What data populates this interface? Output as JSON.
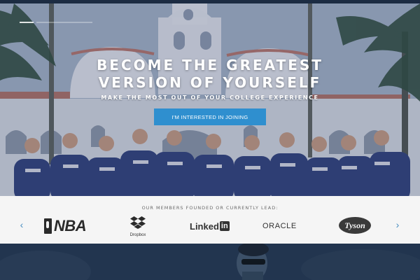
{
  "hero": {
    "headline_line1": "BECOME THE GREATEST",
    "headline_line2": "VERSION OF YOURSELF",
    "subheadline": "MAKE THE MOST OUT OF YOUR COLLEGE EXPERIENCE",
    "cta_label": "I'M INTERESTED IN JOINING",
    "cta_color": "#2f8fcf"
  },
  "members": {
    "caption": "OUR MEMBERS FOUNDED OR CURRENTLY LEAD:",
    "prev_icon": "chevron-left-icon",
    "next_icon": "chevron-right-icon",
    "prev_glyph": "‹",
    "next_glyph": "›",
    "logos": {
      "nba": "NBA",
      "dropbox": "Dropbox",
      "linkedin_text": "Linked",
      "linkedin_box": "in",
      "oracle": "ORACLE",
      "tyson": "Tyson"
    }
  },
  "colors": {
    "dark_navy": "#1c2c43",
    "logo_strip_bg": "#f5f5f5",
    "accent_blue": "#2f8fcf"
  }
}
